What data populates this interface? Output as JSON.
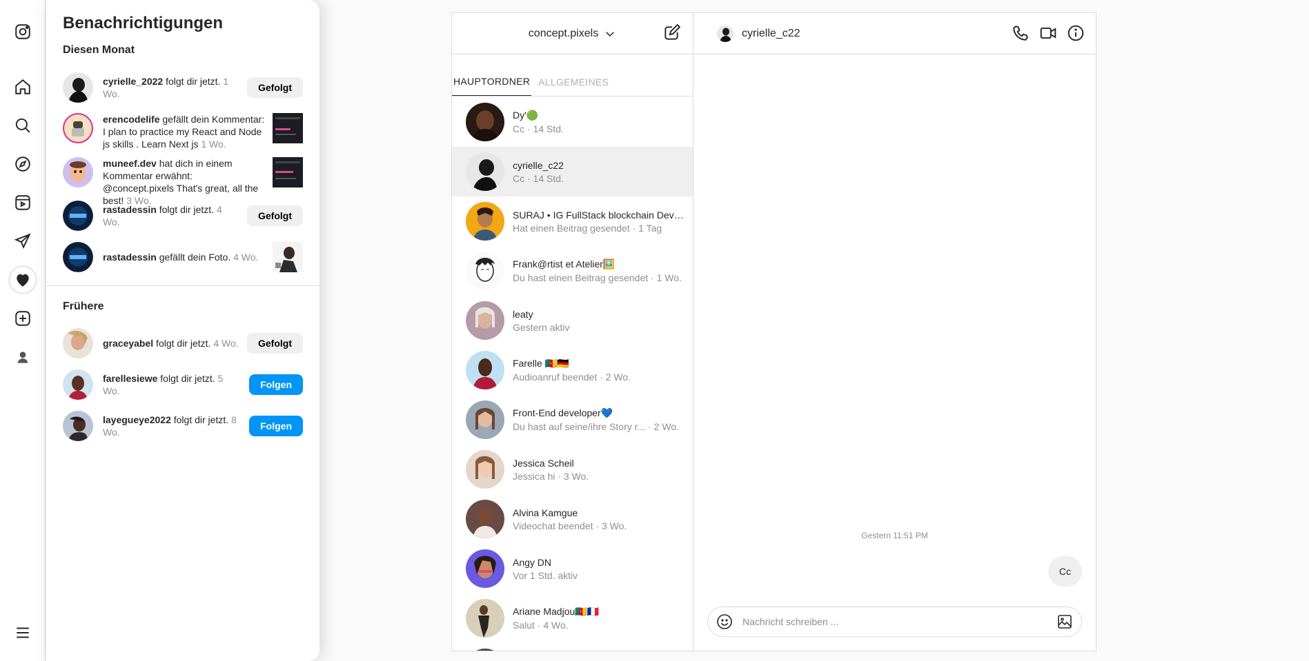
{
  "rail": {
    "icons": [
      "instagram-logo-icon",
      "home-icon",
      "search-icon",
      "explore-icon",
      "reels-icon",
      "direct-messages-icon",
      "notifications-heart-icon",
      "create-icon",
      "profile-avatar",
      "menu-icon"
    ]
  },
  "notifications": {
    "title": "Benachrichtigungen",
    "this_month_label": "Diesen Monat",
    "earlier_label": "Frühere",
    "this_month": [
      {
        "user": "cyrielle_2022",
        "text": " folgt dir jetzt. ",
        "time": "1 Wo.",
        "action": "Gefolgt"
      },
      {
        "user": "erencodelife",
        "text": " gefällt dein Kommentar: I plan to practice my React and Node js skills . Learn Next js ",
        "time": "1 Wo."
      },
      {
        "user": "muneef.dev",
        "text": " hat dich in einem Kommentar erwähnt: @concept.pixels That's great, all the best! ",
        "time": "3 Wo."
      },
      {
        "user": "rastadessin",
        "text": " folgt dir jetzt. ",
        "time": "4 Wo.",
        "action": "Gefolgt"
      },
      {
        "user": "rastadessin",
        "text": " gefällt dein Foto. ",
        "time": "4 Wo."
      }
    ],
    "earlier": [
      {
        "user": "graceyabel",
        "text": " folgt dir jetzt. ",
        "time": "4 Wo.",
        "action": "Gefolgt"
      },
      {
        "user": "farellesiewe",
        "text": " folgt dir jetzt. ",
        "time": "5 Wo.",
        "action": "Folgen"
      },
      {
        "user": "layegueye2022",
        "text": " folgt dir jetzt. ",
        "time": "8 Wo.",
        "action": "Folgen"
      }
    ]
  },
  "dm": {
    "account": "concept.pixels",
    "tabs": [
      "HAUPTORDNER",
      "ALLGEMEINES"
    ],
    "conversations": [
      {
        "name": "Dy'🟢",
        "sub": "Cc · 14 Std."
      },
      {
        "name": "cyrielle_c22",
        "sub": "Cc · 14 Std."
      },
      {
        "name": "SURAJ • IG FullStack blockchain Devel...",
        "sub": "Hat einen Beitrag gesendet · 1 Tag"
      },
      {
        "name": "Frank@rtist et Atelier🖼️",
        "sub": "Du hast einen Beitrag gesendet · 1 Wo."
      },
      {
        "name": "leaty",
        "sub": "Gestern aktiv"
      },
      {
        "name": "Farelle 🇨🇲🇩🇪",
        "sub": "Audioanruf beendet · 2 Wo."
      },
      {
        "name": "Front-End developer💙",
        "sub": "Du hast auf seine/ihre Story r... · 2 Wo."
      },
      {
        "name": "Jessica Scheil",
        "sub": "Jessica hi · 3 Wo."
      },
      {
        "name": "Alvina Kamgue",
        "sub": "Videochat beendet · 3 Wo."
      },
      {
        "name": "Angy DN",
        "sub": "Vor 1 Std. aktiv"
      },
      {
        "name": "Ariane Madjou🇨🇲🇫🇷",
        "sub": "Salut · 4 Wo."
      },
      {
        "name": "",
        "sub": ""
      }
    ],
    "chat": {
      "name": "cyrielle_c22",
      "timestamp": "Gestern 11:51 PM",
      "message": "Cc",
      "placeholder": "Nachricht schreiben ..."
    }
  },
  "colors": {
    "accent": "#0095f6",
    "border": "#dbdbdb",
    "muted": "#8e8e8e"
  }
}
